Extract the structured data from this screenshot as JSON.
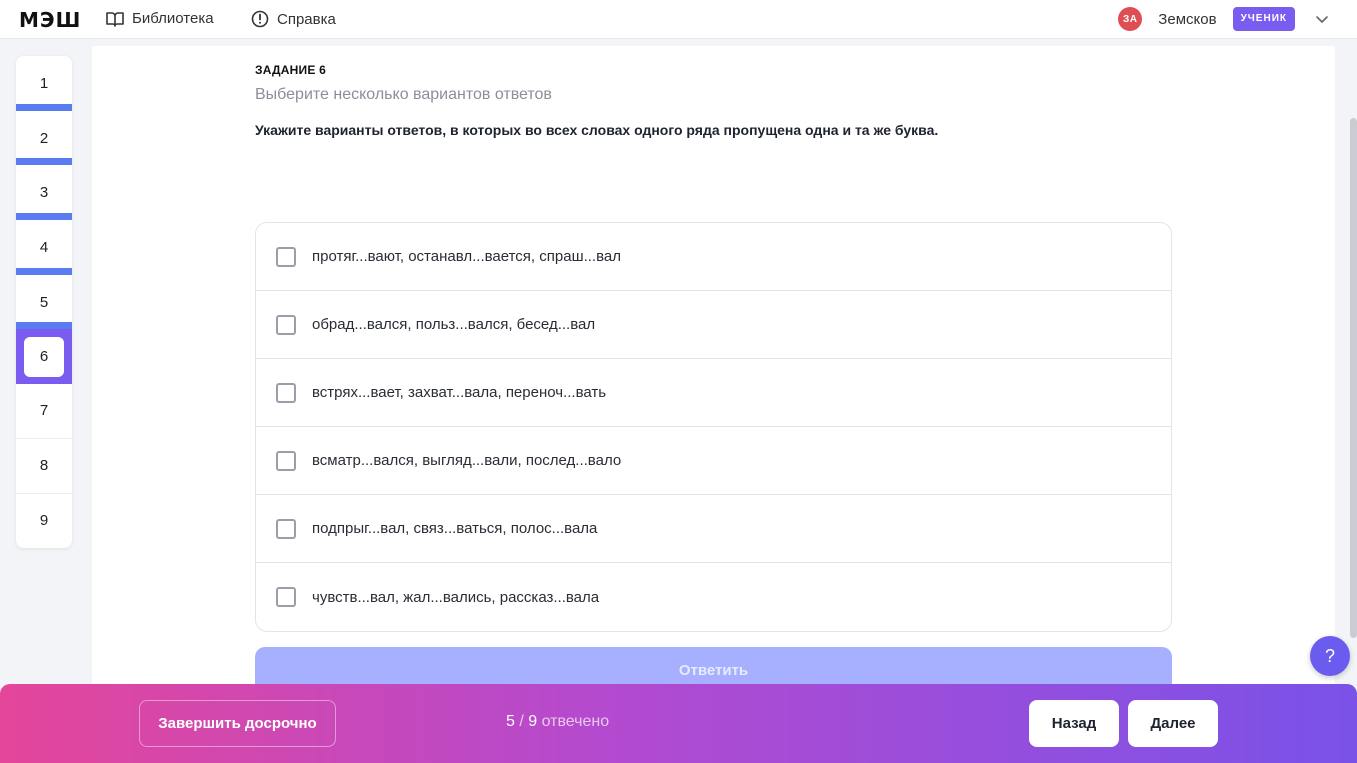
{
  "header": {
    "logo": "МЭШ",
    "nav": {
      "library": "Библиотека",
      "help": "Справка"
    },
    "user": {
      "initials": "ЗА",
      "name": "Земсков",
      "role": "УЧЕНИК"
    }
  },
  "question_nav": {
    "items": [
      {
        "label": "1",
        "state": "answered"
      },
      {
        "label": "2",
        "state": "answered"
      },
      {
        "label": "3",
        "state": "answered"
      },
      {
        "label": "4",
        "state": "answered"
      },
      {
        "label": "5",
        "state": "answered"
      },
      {
        "label": "6",
        "state": "current"
      },
      {
        "label": "7",
        "state": "unanswered"
      },
      {
        "label": "8",
        "state": "unanswered"
      },
      {
        "label": "9",
        "state": "unanswered"
      }
    ]
  },
  "task": {
    "label": "ЗАДАНИЕ 6",
    "hint": "Выберите несколько вариантов ответов",
    "question": "Укажите варианты ответов, в которых во всех словах одного ряда пропущена одна и та же буква.",
    "options": [
      {
        "text": "протяг...вают, останавл...вается, спраш...вал",
        "checked": false
      },
      {
        "text": "обрад...вался, польз...вался, бесед...вал",
        "checked": false
      },
      {
        "text": "встрях...вает, захват...вала, переноч...вать",
        "checked": false
      },
      {
        "text": "всматр...вался, выгляд...вали, послед...вало",
        "checked": false
      },
      {
        "text": "подпрыг...вал, связ...ваться, полос...вала",
        "checked": false
      },
      {
        "text": "чувств...вал, жал...вались, рассказ...вала",
        "checked": false
      }
    ],
    "submit_label": "Ответить"
  },
  "help_fab": "?",
  "footer": {
    "finish_label": "Завершить досрочно",
    "answered": "5",
    "total": "9",
    "answered_suffix": "отвечено",
    "back_label": "Назад",
    "next_label": "Далее"
  },
  "colors": {
    "accent": "#7b5cf0",
    "answered_marker": "#5b7cf0",
    "submit_disabled": "#a7b0ff",
    "avatar": "#e04e55",
    "gradient_start": "#e4469a",
    "gradient_end": "#7a52e8"
  }
}
